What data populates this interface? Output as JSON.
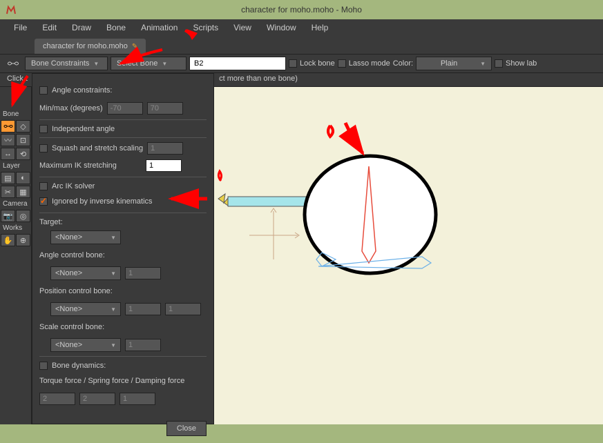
{
  "window": {
    "title": "character for moho.moho - Moho"
  },
  "menu": {
    "items": [
      "File",
      "Edit",
      "Draw",
      "Bone",
      "Animation",
      "Scripts",
      "View",
      "Window",
      "Help"
    ]
  },
  "document_tab": {
    "name": "character for moho.moho"
  },
  "toolbar": {
    "bone_constraints_label": "Bone Constraints",
    "select_bone_label": "Select Bone",
    "bone_name_value": "B2",
    "lock_bone": "Lock bone",
    "lasso_mode": "Lasso mode",
    "color_label": "Color:",
    "color_value": "Plain",
    "show_labels": "Show lab"
  },
  "hint": {
    "text_prefix": "Click t",
    "text_suffix": "ct more than one bone)"
  },
  "sidebar": {
    "sections": [
      {
        "label": "Bone"
      },
      {
        "label": "Layer"
      },
      {
        "label": "Camera"
      },
      {
        "label": "Works"
      }
    ]
  },
  "bone_constraints": {
    "angle_constraints": "Angle constraints:",
    "minmax_label": "Min/max (degrees)",
    "min_value": "-70",
    "max_value": "70",
    "independent_angle": "Independent angle",
    "squash_stretch": "Squash and stretch scaling",
    "squash_value": "1",
    "max_ik_label": "Maximum IK stretching",
    "max_ik_value": "1",
    "arc_ik": "Arc IK solver",
    "ignored_ik": "Ignored by inverse kinematics",
    "target_label": "Target:",
    "target_value": "<None>",
    "angle_control_label": "Angle control bone:",
    "angle_control_value": "<None>",
    "angle_control_num": "1",
    "position_control_label": "Position control bone:",
    "position_control_value": "<None>",
    "position_num1": "1",
    "position_num2": "1",
    "scale_control_label": "Scale control bone:",
    "scale_control_value": "<None>",
    "scale_num": "1",
    "bone_dynamics": "Bone dynamics:",
    "dynamics_label": "Torque force / Spring force / Damping force",
    "torque": "2",
    "spring": "2",
    "damping": "1",
    "close": "Close"
  }
}
